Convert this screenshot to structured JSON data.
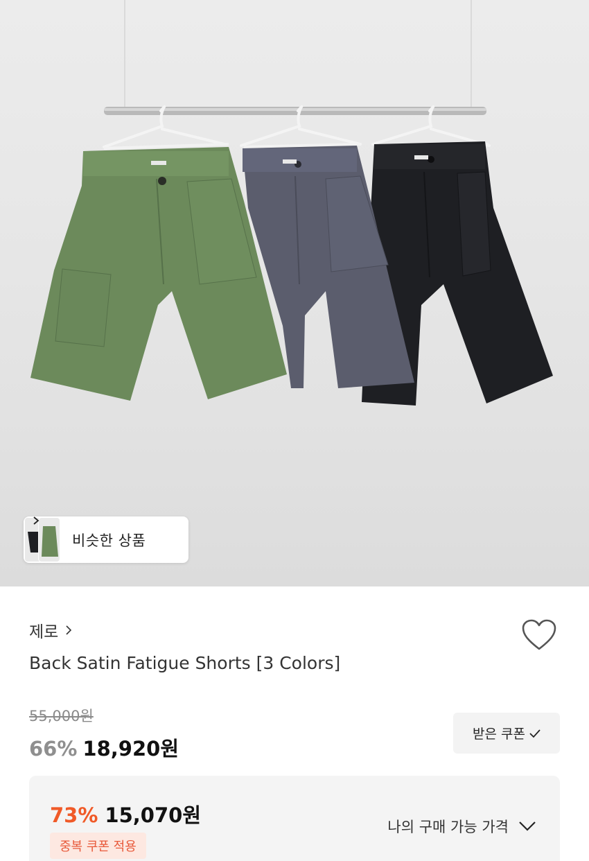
{
  "hero": {
    "image_name": "product-photo-three-shorts-on-hangers",
    "colors": {
      "green": "#6c8a5b",
      "charcoal": "#5b5d6d",
      "black": "#1e1f23"
    }
  },
  "similar": {
    "label": "비슷한 상품"
  },
  "brand": {
    "name": "제로"
  },
  "product": {
    "title": "Back Satin Fatigue Shorts [3 Colors]"
  },
  "price": {
    "original": "55,000원",
    "discount": "66%",
    "sale": "18,920원"
  },
  "coupon": {
    "label": "받은 쿠폰"
  },
  "my_price": {
    "discount": "73%",
    "sale": "15,070원",
    "badge": "중복 쿠폰 적용",
    "toggle_label": "나의 구매 가능 가격"
  },
  "accent": {
    "orange": "#f05a28",
    "badge_bg": "#fde8e1"
  }
}
